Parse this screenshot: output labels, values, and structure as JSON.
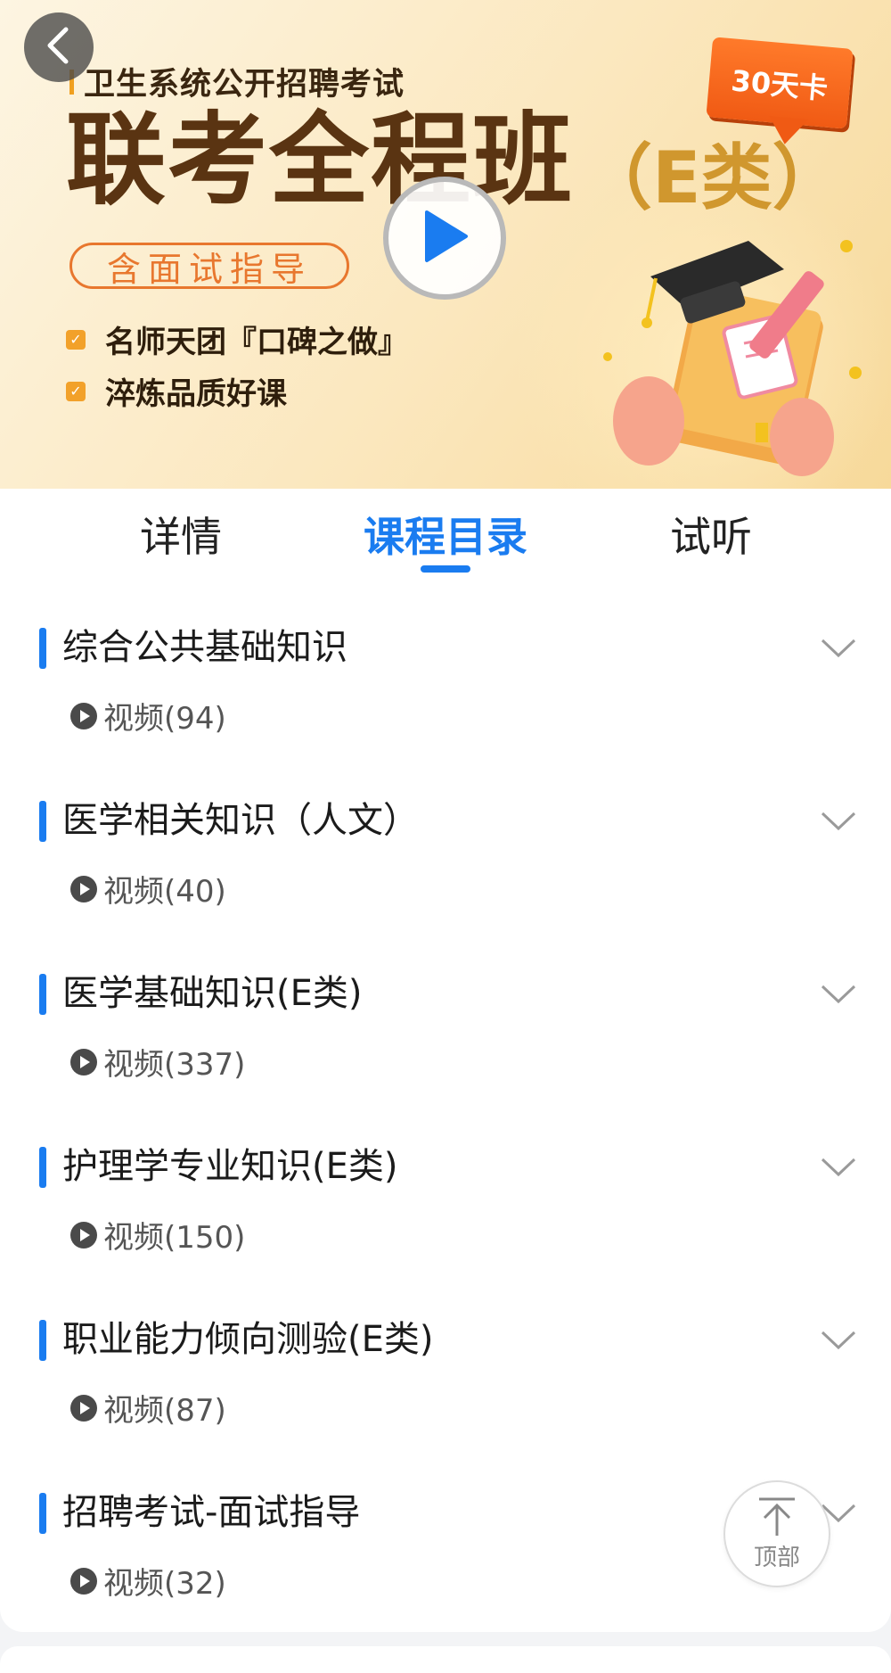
{
  "banner": {
    "subtitle": "卫生系统公开招聘考试",
    "main_title": "联考全程班",
    "type_tag": "（E类）",
    "badge": "30天卡",
    "pill": "含面试指导",
    "features": [
      "名师天团『口碑之做』",
      "淬炼品质好课"
    ],
    "back_icon": "chevron-left-icon",
    "play_icon": "play-icon"
  },
  "tabs": [
    {
      "label": "详情",
      "active": false
    },
    {
      "label": "课程目录",
      "active": true
    },
    {
      "label": "试听",
      "active": false
    }
  ],
  "sections": [
    {
      "title": "综合公共基础知识",
      "meta": "视频(94)"
    },
    {
      "title": "医学相关知识（人文）",
      "meta": "视频(40)"
    },
    {
      "title": "医学基础知识(E类)",
      "meta": "视频(337)"
    },
    {
      "title": "护理学专业知识(E类)",
      "meta": "视频(150)"
    },
    {
      "title": "职业能力倾向测验(E类)",
      "meta": "视频(87)"
    },
    {
      "title": "招聘考试-面试指导",
      "meta": "视频(32)"
    }
  ],
  "back_to_top": {
    "label": "顶部",
    "icon": "arrow-up-to-top-icon"
  },
  "colors": {
    "accent": "#1a7cf0",
    "banner_title": "#5a3412",
    "badge": "#f05a14"
  }
}
